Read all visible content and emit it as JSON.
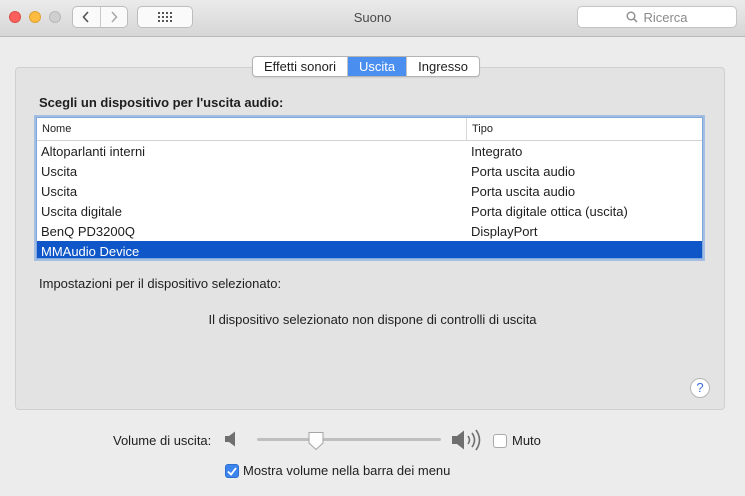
{
  "window": {
    "title": "Suono"
  },
  "toolbar": {
    "search_placeholder": "Ricerca"
  },
  "tabs": [
    {
      "label": "Effetti sonori",
      "active": false
    },
    {
      "label": "Uscita",
      "active": true
    },
    {
      "label": "Ingresso",
      "active": false
    }
  ],
  "output": {
    "heading": "Scegli un dispositivo per l'uscita audio:",
    "columns": {
      "name": "Nome",
      "type": "Tipo"
    },
    "devices": [
      {
        "name": "Altoparlanti interni",
        "type": "Integrato"
      },
      {
        "name": "Uscita",
        "type": "Porta uscita audio"
      },
      {
        "name": "Uscita",
        "type": "Porta uscita audio"
      },
      {
        "name": "Uscita digitale",
        "type": "Porta digitale ottica (uscita)"
      },
      {
        "name": "BenQ PD3200Q",
        "type": "DisplayPort"
      },
      {
        "name": "MMAudio Device",
        "type": "",
        "selected": true
      }
    ],
    "settings_label": "Impostazioni per il dispositivo selezionato:",
    "no_controls_message": "Il dispositivo selezionato non dispone di controlli di uscita"
  },
  "help": {
    "label": "?"
  },
  "volume": {
    "label": "Volume di uscita:",
    "level": 0.32,
    "mute_label": "Muto",
    "mute_checked": false
  },
  "menubar_option": {
    "label": "Mostra volume nella barra dei menu",
    "checked": true
  },
  "colors": {
    "accent": "#4a8ef0",
    "selection": "#0f57c8",
    "close": "#fc605c",
    "minimize": "#fdbc40"
  },
  "icons": [
    "chevron-left-icon",
    "chevron-right-icon",
    "grid-icon",
    "search-icon",
    "speaker-low-icon",
    "speaker-high-icon",
    "checkmark-icon",
    "help-icon"
  ]
}
